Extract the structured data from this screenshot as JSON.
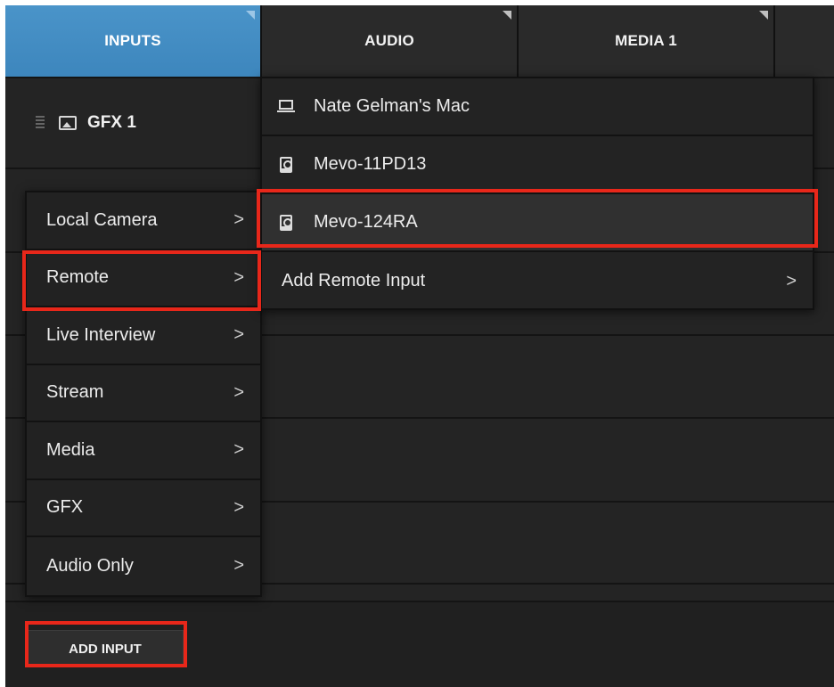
{
  "tabs": [
    {
      "label": "INPUTS",
      "active": true
    },
    {
      "label": "AUDIO",
      "active": false
    },
    {
      "label": "MEDIA 1",
      "active": false
    }
  ],
  "input_row": {
    "label": "GFX 1",
    "icon": "image-icon"
  },
  "add_input_label": "ADD INPUT",
  "menu": {
    "items": [
      {
        "label": "Local Camera",
        "chevron": ">"
      },
      {
        "label": "Remote",
        "chevron": ">",
        "highlighted": true
      },
      {
        "label": "Live Interview",
        "chevron": ">"
      },
      {
        "label": "Stream",
        "chevron": ">"
      },
      {
        "label": "Media",
        "chevron": ">"
      },
      {
        "label": "GFX",
        "chevron": ">"
      },
      {
        "label": "Audio Only",
        "chevron": ">"
      }
    ]
  },
  "submenu": {
    "items": [
      {
        "label": "Nate Gelman's Mac",
        "icon": "laptop-icon"
      },
      {
        "label": "Mevo-11PD13",
        "icon": "camera-icon"
      },
      {
        "label": "Mevo-124RA",
        "icon": "camera-icon",
        "highlighted": true
      },
      {
        "label": "Add Remote Input",
        "chevron": ">"
      }
    ]
  },
  "colors": {
    "accent_tab": "#4a94c9",
    "highlight_box": "#e8271a",
    "background": "#242424"
  }
}
